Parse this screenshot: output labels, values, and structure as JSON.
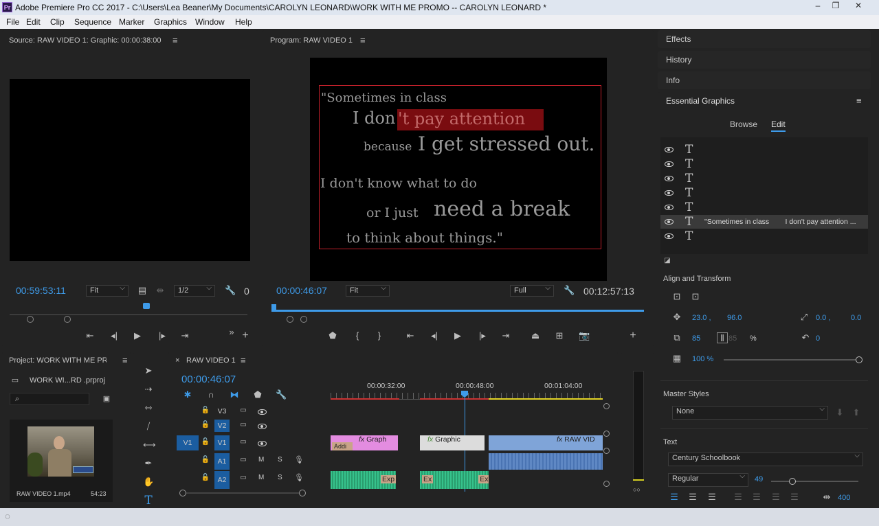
{
  "window": {
    "title": "Adobe Premiere Pro CC 2017 - C:\\Users\\Lea Beaner\\My Documents\\CAROLYN LEONARD\\WORK WITH ME PROMO -- CAROLYN LEONARD  *",
    "app_badge": "Pr"
  },
  "menu": [
    "File",
    "Edit",
    "Clip",
    "Sequence",
    "Marker",
    "Graphics",
    "Window",
    "Help"
  ],
  "source": {
    "title": "Source: RAW VIDEO 1: Graphic: 00:00:38:00",
    "timecode": "00:59:53:11",
    "fit": "Fit",
    "resolution": "1/2",
    "duration": "0"
  },
  "program": {
    "title": "Program: RAW VIDEO 1",
    "timecode": "00:00:46:07",
    "fit": "Fit",
    "quality": "Full",
    "duration": "00:12:57:13",
    "text_lines": [
      "\"Sometimes in class",
      "I don",
      "'t pay attention",
      "because",
      "I get stressed out.",
      "I don't know what to do",
      "or I just",
      "need a break",
      "to think about things.\""
    ]
  },
  "right_panels": {
    "effects": "Effects",
    "history": "History",
    "info": "Info",
    "essential_graphics": "Essential Graphics",
    "tab_browse": "Browse",
    "tab_edit": "Edit",
    "selected_layer_text": "\"Sometimes in class        I don't pay attention ...",
    "align_transform": "Align and Transform",
    "pos_x": "23.0 ,",
    "pos_y": "96.0",
    "anchor_x": "0.0 ,",
    "anchor_y": "0.0",
    "scale": "85",
    "scale2": "85",
    "percent": "%",
    "rotation": "0",
    "opacity": "100 %",
    "master_styles": "Master Styles",
    "master_style_value": "None",
    "text_label": "Text",
    "font": "Century Schoolbook",
    "font_style": "Regular",
    "font_size": "49",
    "tracking": "400"
  },
  "project": {
    "title": "Project: WORK WITH ME PR",
    "file": "WORK WI...RD .prproj",
    "clip_name": "RAW VIDEO 1.mp4",
    "clip_duration": "54:23"
  },
  "timeline": {
    "tab": "RAW VIDEO 1",
    "timecode": "00:00:46:07",
    "ruler": [
      "00:00:32:00",
      "00:00:48:00",
      "00:01:04:00"
    ],
    "tracks": {
      "v3": "V3",
      "v2": "V2",
      "v1": "V1",
      "v1_src": "V1",
      "a1": "A1",
      "a2": "A2",
      "m": "M",
      "s": "S"
    },
    "clips": {
      "c1": "Graph",
      "c1b": "Addi",
      "c2": "Graphic",
      "c3": "RAW VID",
      "a2c1": "Exp",
      "a2c2": "Ex",
      "a2c3": "Ex"
    }
  }
}
